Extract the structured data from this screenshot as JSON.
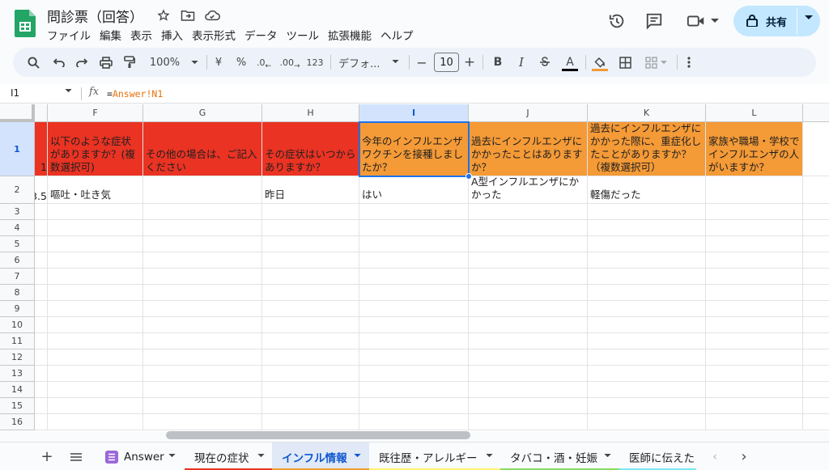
{
  "app": {
    "doc_title": "問診票（回答）",
    "menu": [
      "ファイル",
      "編集",
      "表示",
      "挿入",
      "表示形式",
      "データ",
      "ツール",
      "拡張機能",
      "ヘルプ"
    ],
    "share_label": "共有"
  },
  "toolbar": {
    "zoom": "100%",
    "currency": "¥",
    "percent": "%",
    "dec_decrease": ".0",
    "dec_increase": ".00",
    "number_format": "123",
    "font": "デフォ...",
    "font_size": "10"
  },
  "formula_bar": {
    "cell_ref": "I1",
    "fx": "fx",
    "formula_prefix": "=",
    "formula_ref": "Answer!N1"
  },
  "grid": {
    "columns": [
      "F",
      "G",
      "H",
      "I",
      "J",
      "K",
      "L"
    ],
    "rows": [
      "1",
      "2",
      "3",
      "4",
      "5",
      "6",
      "7",
      "8",
      "9",
      "10",
      "11",
      "12",
      "13",
      "14",
      "15",
      "16"
    ],
    "partial_row1": "1",
    "partial_row2": "3.5",
    "row1": {
      "F": "以下のような症状がありますか？(複数選択可)",
      "G": "その他の場合は、ご記入ください",
      "H": "その症状はいつからありますか？",
      "I": "今年のインフルエンザワクチンを接種しましたか？",
      "J": "過去にインフルエンザにかかったことはありますか？",
      "K": "過去にインフルエンザにかかった際に、重症化したことがありますか？（複数選択可）",
      "L": "家族や職場・学校でインフルエンザの人がいますか？"
    },
    "row2": {
      "F": "嘔吐・吐き気",
      "G": "",
      "H": "昨日",
      "I": "はい",
      "J": "A型インフルエンザにかかった",
      "K": "軽傷だった",
      "L": ""
    }
  },
  "sheet_tabs": [
    {
      "label": "Answer",
      "color": "#9a67d6"
    },
    {
      "label": "現在の症状",
      "color": "#ea3323"
    },
    {
      "label": "インフル情報",
      "color": "#f49a37"
    },
    {
      "label": "既往歴・アレルギー",
      "color": "#fff176"
    },
    {
      "label": "タバコ・酒・妊娠",
      "color": "#8bdc66"
    },
    {
      "label": "医師に伝えた",
      "color": "#7de7ef"
    }
  ],
  "colors": {
    "header_red": "#ea3323",
    "header_orange": "#f49a37",
    "selection": "#1a73e8"
  }
}
